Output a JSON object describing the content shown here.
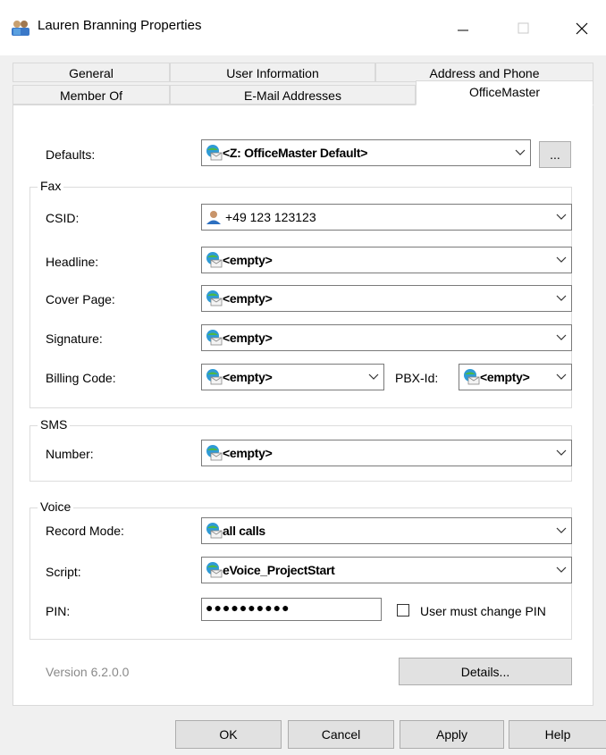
{
  "window": {
    "title": "Lauren Branning Properties",
    "controls": {
      "minimize_glyph": "—",
      "maximize_glyph": "☐",
      "close_glyph": "✕"
    }
  },
  "tabs": {
    "row1": [
      "General",
      "User Information",
      "Address and Phone"
    ],
    "row2": [
      "Member Of",
      "E-Mail Addresses",
      "OfficeMaster"
    ],
    "active": "OfficeMaster"
  },
  "defaults": {
    "label": "Defaults:",
    "value": "<Z: OfficeMaster Default>",
    "browse_label": "..."
  },
  "fax": {
    "group_title": "Fax",
    "csid_label": "CSID:",
    "csid_value": "+49 123 123123",
    "headline_label": "Headline:",
    "headline_value": "<empty>",
    "cover_label": "Cover Page:",
    "cover_value": "<empty>",
    "signature_label": "Signature:",
    "signature_value": "<empty>",
    "billing_label": "Billing Code:",
    "billing_value": "<empty>",
    "pbx_label": "PBX-Id:",
    "pbx_value": "<empty>"
  },
  "sms": {
    "group_title": "SMS",
    "number_label": "Number:",
    "number_value": "<empty>"
  },
  "voice": {
    "group_title": "Voice",
    "record_label": "Record Mode:",
    "record_value": "all calls",
    "script_label": "Script:",
    "script_value": "eVoice_ProjectStart",
    "pin_label": "PIN:",
    "pin_value": "●●●●●●●●●●",
    "must_change_label": "User must change PIN"
  },
  "footer": {
    "version": "Version 6.2.0.0",
    "details_label": "Details...",
    "ok_label": "OK",
    "cancel_label": "Cancel",
    "apply_label": "Apply",
    "help_label": "Help"
  },
  "colors": {
    "dialog_bg": "#f0f0f0",
    "tab_page_bg": "#ffffff",
    "button_bg": "#e1e1e1",
    "disabled_text": "#8a8a8a"
  },
  "icons": {
    "combo_source_icon": "globe-envelope-icon",
    "csid_icon": "user-icon",
    "app_icon": "users-icon"
  }
}
